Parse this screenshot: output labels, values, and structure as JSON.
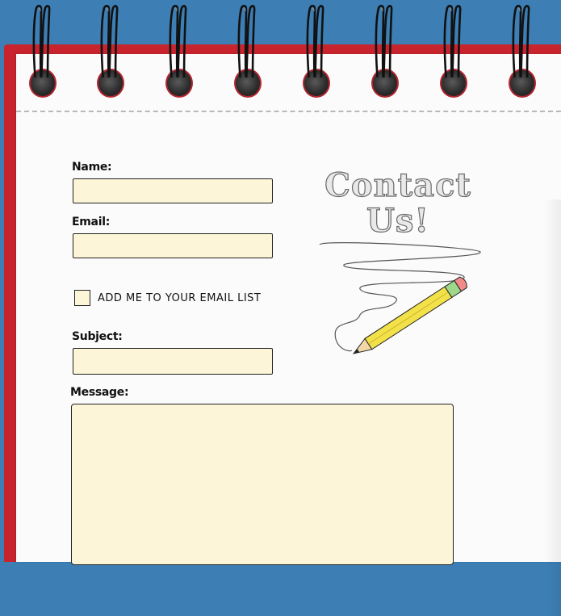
{
  "form": {
    "name_label": "Name:",
    "email_label": "Email:",
    "checkbox_label": "Add me to your email list",
    "subject_label": "Subject:",
    "message_label": "Message:",
    "name_value": "",
    "email_value": "",
    "subject_value": "",
    "message_value": "",
    "checkbox_checked": false
  },
  "heading": {
    "line1": "Contact",
    "line2": "Us!"
  },
  "colors": {
    "background": "#3d7fb5",
    "notebook_border": "#c8242e",
    "paper": "#fbfbfb",
    "field_fill": "#fdf5d8",
    "pencil_body": "#f3e14a",
    "pencil_eraser": "#f28a8a",
    "pencil_ferrule": "#9ed98a"
  },
  "icons": {
    "decoration": "pencil-icon",
    "binding": "spiral-ring-icon"
  }
}
